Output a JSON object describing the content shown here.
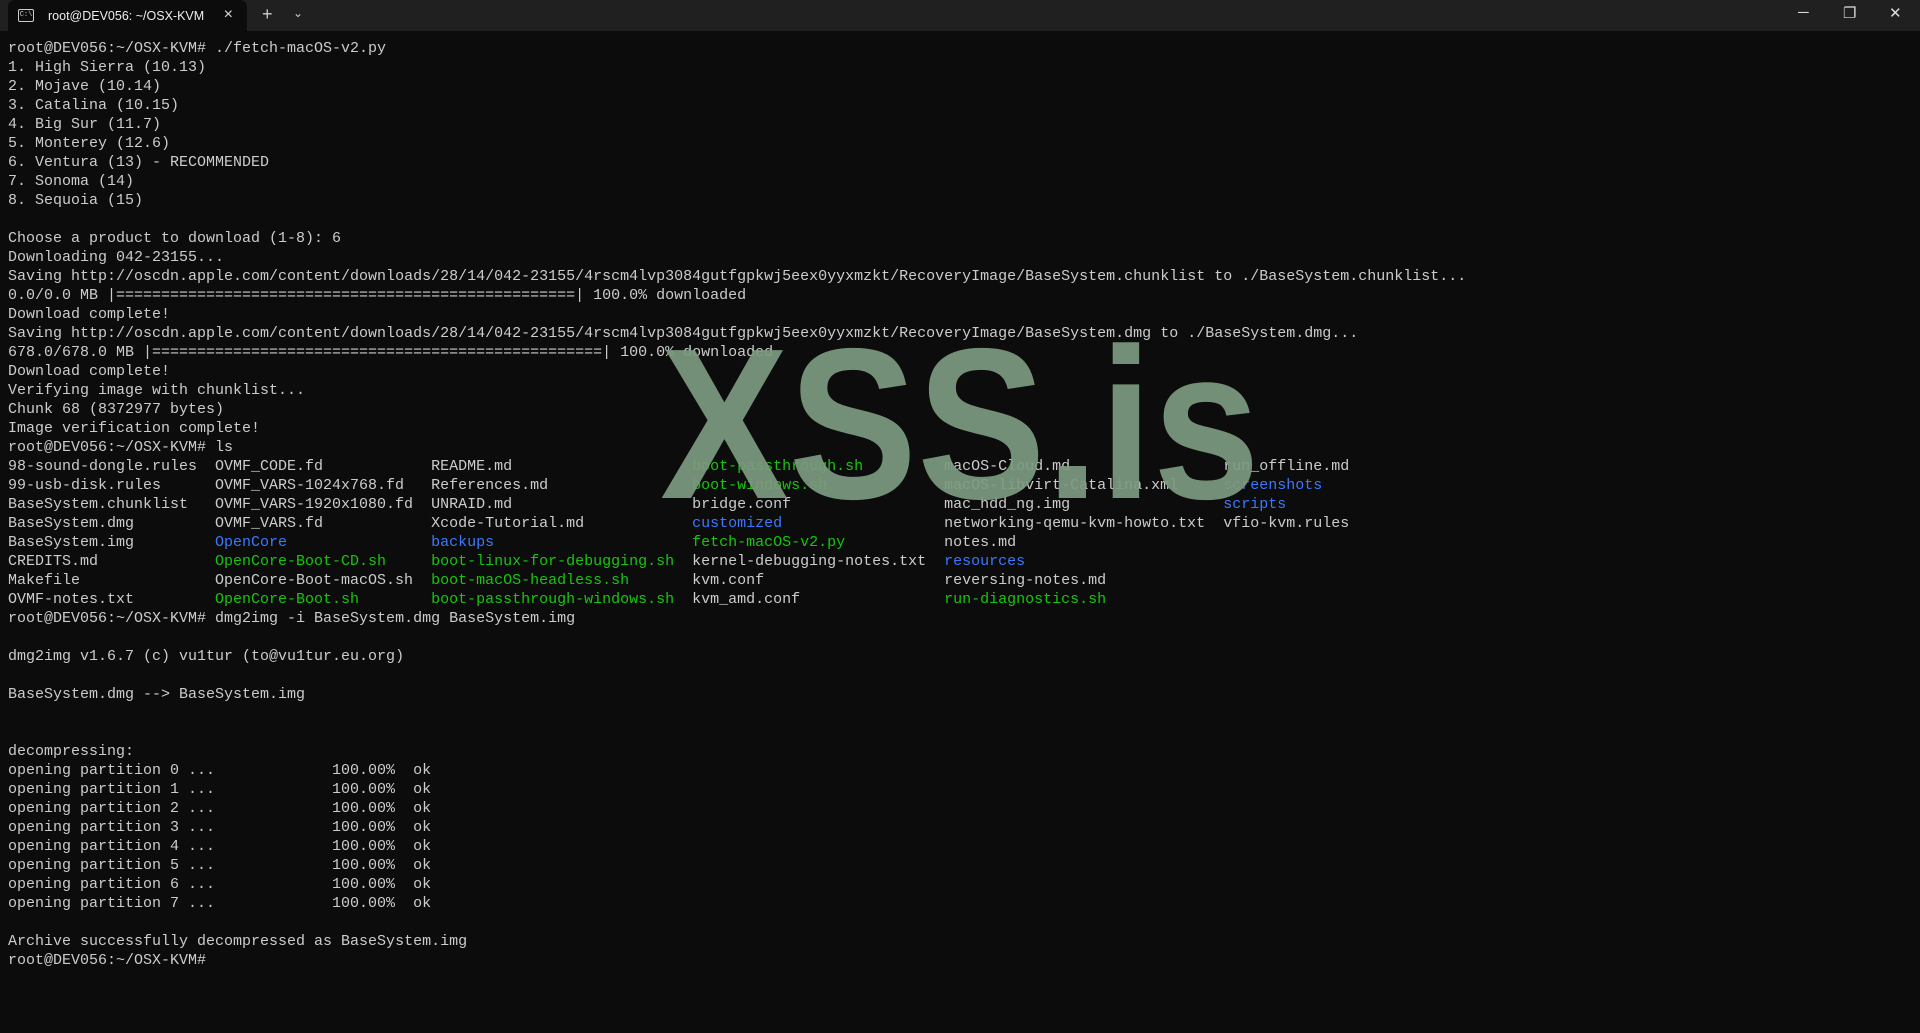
{
  "window": {
    "tab_title": "root@DEV056: ~/OSX-KVM",
    "tab_icon": "terminal-icon",
    "close_tab": "×",
    "new_tab": "+",
    "dropdown": "⌄",
    "minimize": "─",
    "maximize": "❐",
    "close": "✕"
  },
  "colors": {
    "background": "#0c0c0c",
    "text": "#cccccc",
    "directory": "#3b78ff",
    "executable": "#16c60c",
    "watermark": "#7d9a80"
  },
  "terminal": {
    "lines_before": [
      "root@DEV056:~/OSX-KVM# ./fetch-macOS-v2.py",
      "1. High Sierra (10.13)",
      "2. Mojave (10.14)",
      "3. Catalina (10.15)",
      "4. Big Sur (11.7)",
      "5. Monterey (12.6)",
      "6. Ventura (13) - RECOMMENDED",
      "7. Sonoma (14)",
      "8. Sequoia (15)",
      "",
      "Choose a product to download (1-8): 6",
      "Downloading 042-23155...",
      "Saving http://oscdn.apple.com/content/downloads/28/14/042-23155/4rscm4lvp3084gutfgpkwj5eex0yyxmzkt/RecoveryImage/BaseSystem.chunklist to ./BaseSystem.chunklist...",
      "0.0/0.0 MB |===================================================| 100.0% downloaded",
      "Download complete!",
      "Saving http://oscdn.apple.com/content/downloads/28/14/042-23155/4rscm4lvp3084gutfgpkwj5eex0yyxmzkt/RecoveryImage/BaseSystem.dmg to ./BaseSystem.dmg...",
      "678.0/678.0 MB |==================================================| 100.0% downloaded",
      "Download complete!",
      "Verifying image with chunklist...",
      "Chunk 68 (8372977 bytes)",
      "Image verification complete!",
      "root@DEV056:~/OSX-KVM# ls"
    ],
    "ls_rows": [
      [
        {
          "n": "98-sound-dongle.rules",
          "t": "file"
        },
        {
          "n": "OVMF_CODE.fd",
          "t": "file"
        },
        {
          "n": "README.md",
          "t": "file"
        },
        {
          "n": "boot-passthrough.sh",
          "t": "exec"
        },
        {
          "n": "macOS-Cloud.md",
          "t": "file"
        },
        {
          "n": "run_offline.md",
          "t": "file"
        }
      ],
      [
        {
          "n": "99-usb-disk.rules",
          "t": "file"
        },
        {
          "n": "OVMF_VARS-1024x768.fd",
          "t": "file"
        },
        {
          "n": "References.md",
          "t": "file"
        },
        {
          "n": "boot-windows.sh",
          "t": "exec"
        },
        {
          "n": "macOS-libvirt-Catalina.xml",
          "t": "file"
        },
        {
          "n": "screenshots",
          "t": "dir"
        }
      ],
      [
        {
          "n": "BaseSystem.chunklist",
          "t": "file"
        },
        {
          "n": "OVMF_VARS-1920x1080.fd",
          "t": "file"
        },
        {
          "n": "UNRAID.md",
          "t": "file"
        },
        {
          "n": "bridge.conf",
          "t": "file"
        },
        {
          "n": "mac_hdd_ng.img",
          "t": "file"
        },
        {
          "n": "scripts",
          "t": "dir"
        }
      ],
      [
        {
          "n": "BaseSystem.dmg",
          "t": "file"
        },
        {
          "n": "OVMF_VARS.fd",
          "t": "file"
        },
        {
          "n": "Xcode-Tutorial.md",
          "t": "file"
        },
        {
          "n": "customized",
          "t": "dir"
        },
        {
          "n": "networking-qemu-kvm-howto.txt",
          "t": "file"
        },
        {
          "n": "vfio-kvm.rules",
          "t": "file"
        }
      ],
      [
        {
          "n": "BaseSystem.img",
          "t": "file"
        },
        {
          "n": "OpenCore",
          "t": "dir"
        },
        {
          "n": "backups",
          "t": "dir"
        },
        {
          "n": "fetch-macOS-v2.py",
          "t": "exec"
        },
        {
          "n": "notes.md",
          "t": "file"
        }
      ],
      [
        {
          "n": "CREDITS.md",
          "t": "file"
        },
        {
          "n": "OpenCore-Boot-CD.sh",
          "t": "exec"
        },
        {
          "n": "boot-linux-for-debugging.sh",
          "t": "exec"
        },
        {
          "n": "kernel-debugging-notes.txt",
          "t": "file"
        },
        {
          "n": "resources",
          "t": "dir"
        }
      ],
      [
        {
          "n": "Makefile",
          "t": "file"
        },
        {
          "n": "OpenCore-Boot-macOS.sh",
          "t": "file"
        },
        {
          "n": "boot-macOS-headless.sh",
          "t": "exec"
        },
        {
          "n": "kvm.conf",
          "t": "file"
        },
        {
          "n": "reversing-notes.md",
          "t": "file"
        }
      ],
      [
        {
          "n": "OVMF-notes.txt",
          "t": "file"
        },
        {
          "n": "OpenCore-Boot.sh",
          "t": "exec"
        },
        {
          "n": "boot-passthrough-windows.sh",
          "t": "exec"
        },
        {
          "n": "kvm_amd.conf",
          "t": "file"
        },
        {
          "n": "run-diagnostics.sh",
          "t": "exec"
        }
      ]
    ],
    "lines_after": [
      "root@DEV056:~/OSX-KVM# dmg2img -i BaseSystem.dmg BaseSystem.img",
      "",
      "dmg2img v1.6.7 (c) vu1tur (to@vu1tur.eu.org)",
      "",
      "BaseSystem.dmg --> BaseSystem.img",
      "",
      "",
      "decompressing:",
      "opening partition 0 ...             100.00%  ok",
      "opening partition 1 ...             100.00%  ok",
      "opening partition 2 ...             100.00%  ok",
      "opening partition 3 ...             100.00%  ok",
      "opening partition 4 ...             100.00%  ok",
      "opening partition 5 ...             100.00%  ok",
      "opening partition 6 ...             100.00%  ok",
      "opening partition 7 ...             100.00%  ok",
      "",
      "Archive successfully decompressed as BaseSystem.img",
      "root@DEV056:~/OSX-KVM# "
    ]
  },
  "watermark": {
    "text": "XSS.is"
  }
}
